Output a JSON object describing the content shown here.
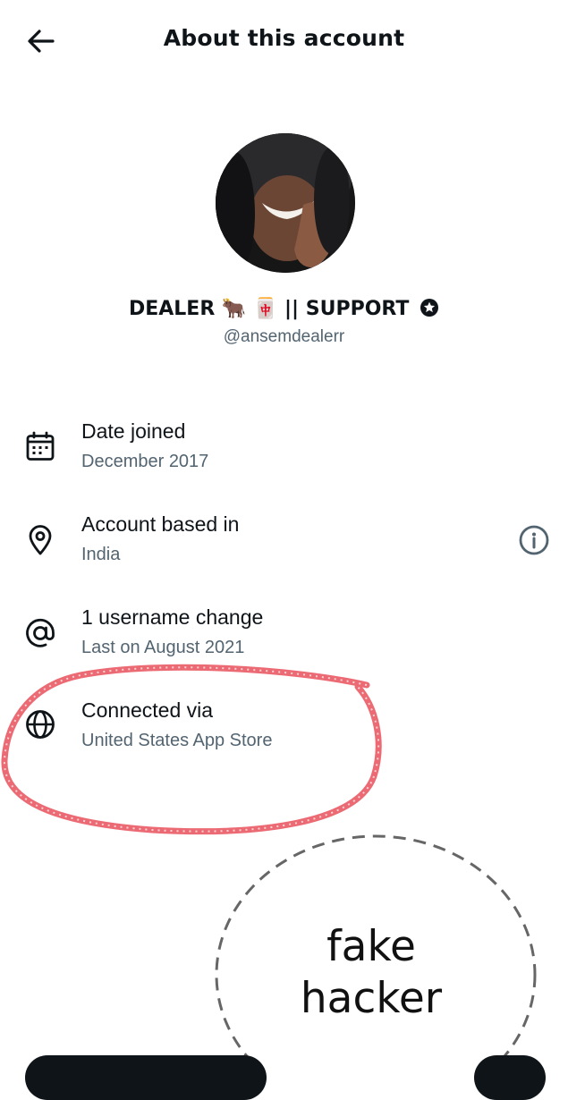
{
  "header": {
    "title": "About this account",
    "back_icon": "arrow-left-icon"
  },
  "profile": {
    "display_name": "DEALER 🐂 🀄 || SUPPORT",
    "badge_icon": "verified-star-icon",
    "handle": "@ansemdealerr"
  },
  "info_items": [
    {
      "icon": "calendar-icon",
      "label": "Date joined",
      "value": "December 2017"
    },
    {
      "icon": "location-pin-icon",
      "label": "Account based in",
      "value": "India",
      "action_icon": "info-icon"
    },
    {
      "icon": "at-sign-icon",
      "label": "1 username change",
      "value": "Last on August 2021"
    },
    {
      "icon": "globe-icon",
      "label": "Connected via",
      "value": "United States App Store"
    }
  ],
  "annotations": {
    "circled_item": "Connected via",
    "circle_color": "#e8505b",
    "caption_line1": "fake",
    "caption_line2": "hacker"
  },
  "colors": {
    "text": "#0f1419",
    "secondary": "#536471",
    "background": "#ffffff"
  }
}
